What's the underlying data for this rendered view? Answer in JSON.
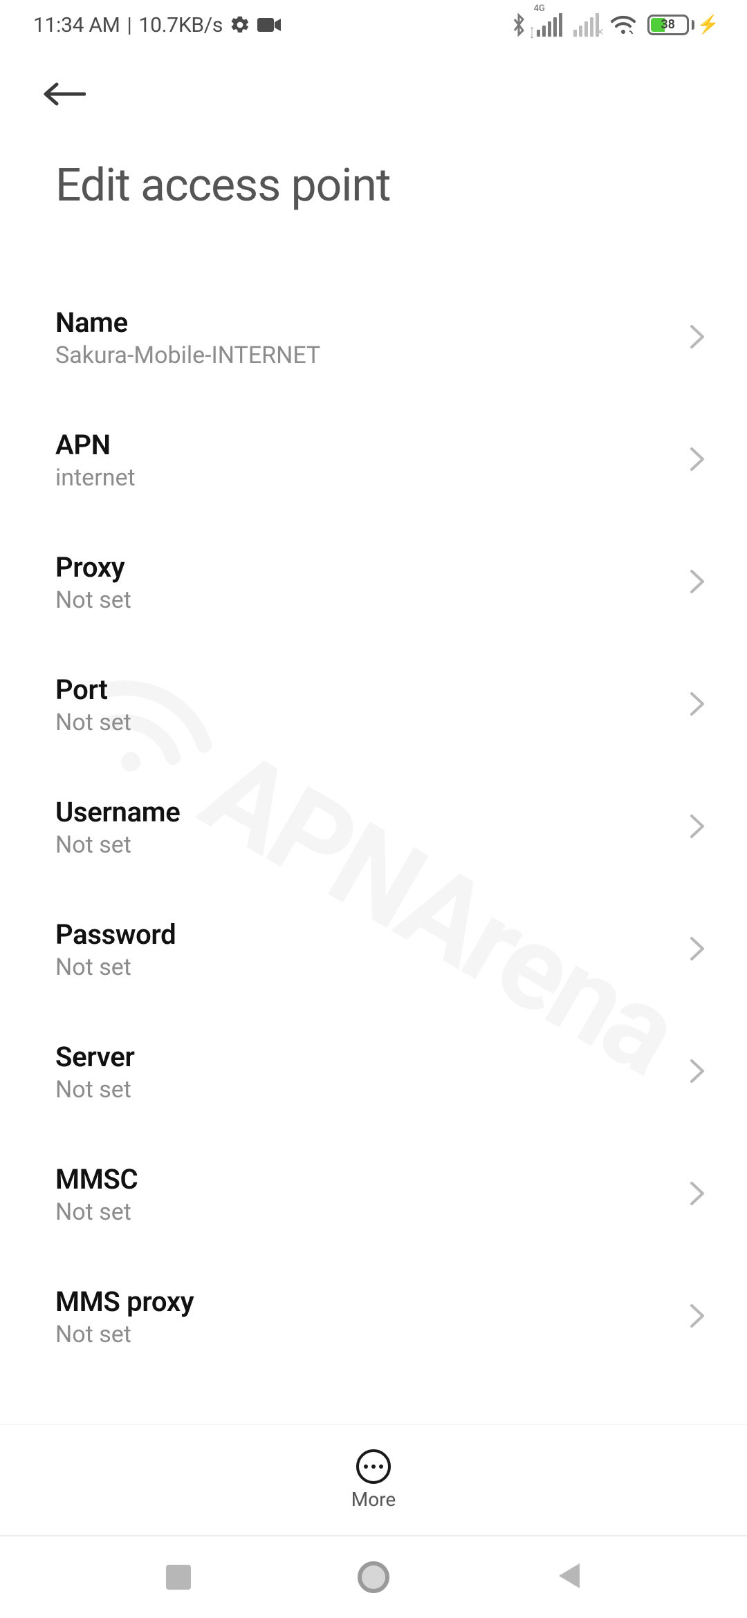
{
  "status": {
    "time": "11:34 AM",
    "divider": "|",
    "netspeed": "10.7KB/s",
    "sig_label": "4G",
    "battery_pct": "38"
  },
  "header": {
    "title": "Edit access point"
  },
  "settings": [
    {
      "label": "Name",
      "value": "Sakura-Mobile-INTERNET",
      "name": "apn-name"
    },
    {
      "label": "APN",
      "value": "internet",
      "name": "apn-apn"
    },
    {
      "label": "Proxy",
      "value": "Not set",
      "name": "apn-proxy"
    },
    {
      "label": "Port",
      "value": "Not set",
      "name": "apn-port"
    },
    {
      "label": "Username",
      "value": "Not set",
      "name": "apn-username"
    },
    {
      "label": "Password",
      "value": "Not set",
      "name": "apn-password"
    },
    {
      "label": "Server",
      "value": "Not set",
      "name": "apn-server"
    },
    {
      "label": "MMSC",
      "value": "Not set",
      "name": "apn-mmsc"
    },
    {
      "label": "MMS proxy",
      "value": "Not set",
      "name": "apn-mmsproxy"
    }
  ],
  "footer": {
    "more_label": "More"
  },
  "watermark": "APNArena"
}
